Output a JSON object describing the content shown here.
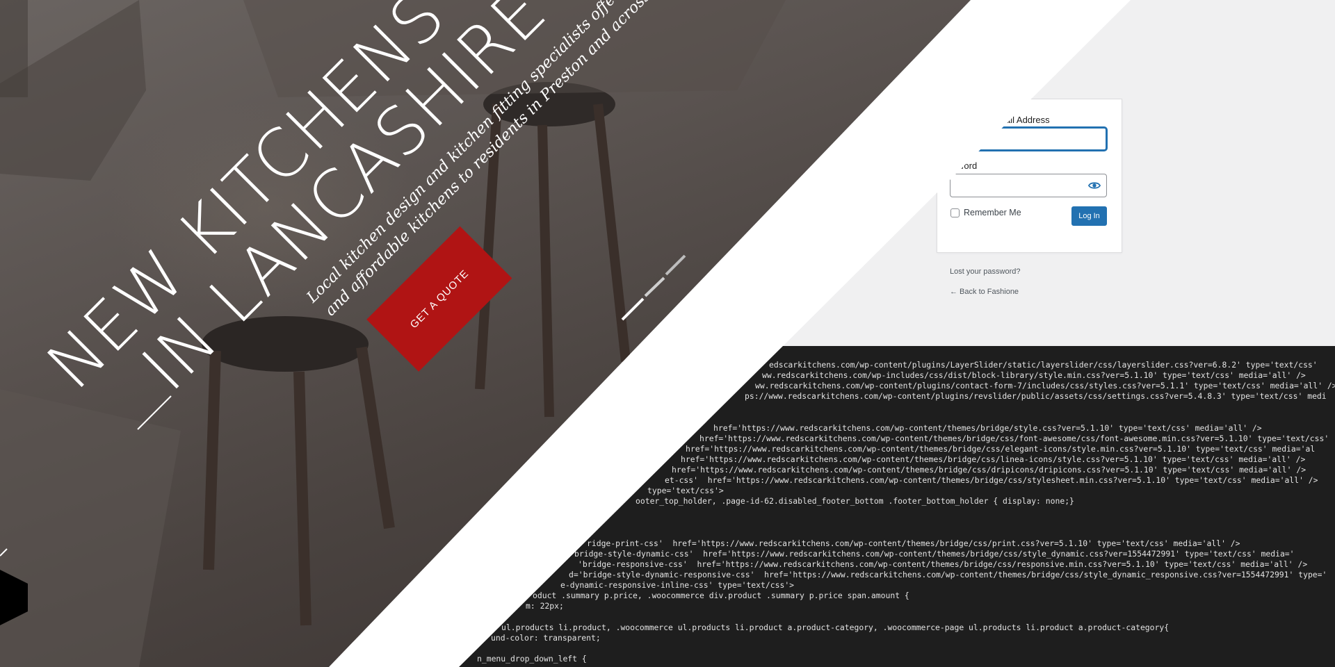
{
  "hero": {
    "title_line1": "NEW KITCHENS",
    "title_line2": "IN LANCASHIRE",
    "subtitle_line1": "Local kitchen design and kitchen fitting specialists offering a range of high quality",
    "subtitle_line2": "and affordable kitchens to residents in Preston and across Lancashire.",
    "cta_label": "GET A QUOTE",
    "cta_color": "#b01414"
  },
  "login": {
    "email_label": "ail Address",
    "email_value": "",
    "password_label": "word",
    "password_value": "",
    "remember_label": "Remember Me",
    "submit_label": "Log In",
    "lost_password": "Lost your password?",
    "back_link": "← Back to Fashione",
    "accent_color": "#2271b1"
  },
  "code": {
    "lines": [
      "edscarkitchens.com/wp-content/plugins/LayerSlider/static/layerslider/css/layerslider.css?ver=6.8.2' type='text/css'",
      "ww.redscarkitchens.com/wp-includes/css/dist/block-library/style.min.css?ver=5.1.10' type='text/css' media='all' />",
      "ww.redscarkitchens.com/wp-content/plugins/contact-form-7/includes/css/styles.css?ver=5.1.1' type='text/css' media='all' />",
      "ps://www.redscarkitchens.com/wp-content/plugins/revslider/public/assets/css/settings.css?ver=5.4.8.3' type='text/css' medi",
      "",
      "",
      "href='https://www.redscarkitchens.com/wp-content/themes/bridge/style.css?ver=5.1.10' type='text/css' media='all' />",
      "href='https://www.redscarkitchens.com/wp-content/themes/bridge/css/font-awesome/css/font-awesome.min.css?ver=5.1.10' type='text/css'",
      "href='https://www.redscarkitchens.com/wp-content/themes/bridge/css/elegant-icons/style.min.css?ver=5.1.10' type='text/css' media='al",
      "href='https://www.redscarkitchens.com/wp-content/themes/bridge/css/linea-icons/style.css?ver=5.1.10' type='text/css' media='all' />",
      "href='https://www.redscarkitchens.com/wp-content/themes/bridge/css/dripicons/dripicons.css?ver=5.1.10' type='text/css' media='all' />",
      "et-css'  href='https://www.redscarkitchens.com/wp-content/themes/bridge/css/stylesheet.min.css?ver=5.1.10' type='text/css' media='all' />",
      "type='text/css'>",
      "ooter_top_holder, .page-id-62.disabled_footer_bottom .footer_bottom_holder { display: none;}",
      "",
      "",
      "",
      "ridge-print-css'  href='https://www.redscarkitchens.com/wp-content/themes/bridge/css/print.css?ver=5.1.10' type='text/css' media='all' />",
      "bridge-style-dynamic-css'  href='https://www.redscarkitchens.com/wp-content/themes/bridge/css/style_dynamic.css?ver=1554472991' type='text/css' media='",
      "'bridge-responsive-css'  href='https://www.redscarkitchens.com/wp-content/themes/bridge/css/responsive.min.css?ver=5.1.10' type='text/css' media='all' />",
      "d='bridge-style-dynamic-responsive-css'  href='https://www.redscarkitchens.com/wp-content/themes/bridge/css/style_dynamic_responsive.css?ver=1554472991' type='",
      "e-dynamic-responsive-inline-css' type='text/css'>",
      "oduct .summary p.price, .woocommerce div.product .summary p.price span.amount {",
      "m: 22px;",
      "",
      "ul.products li.product, .woocommerce ul.products li.product a.product-category, .woocommerce-page ul.products li.product a.product-category{",
      "und-color: transparent;",
      "",
      "n_menu_drop_down_left {"
    ]
  }
}
